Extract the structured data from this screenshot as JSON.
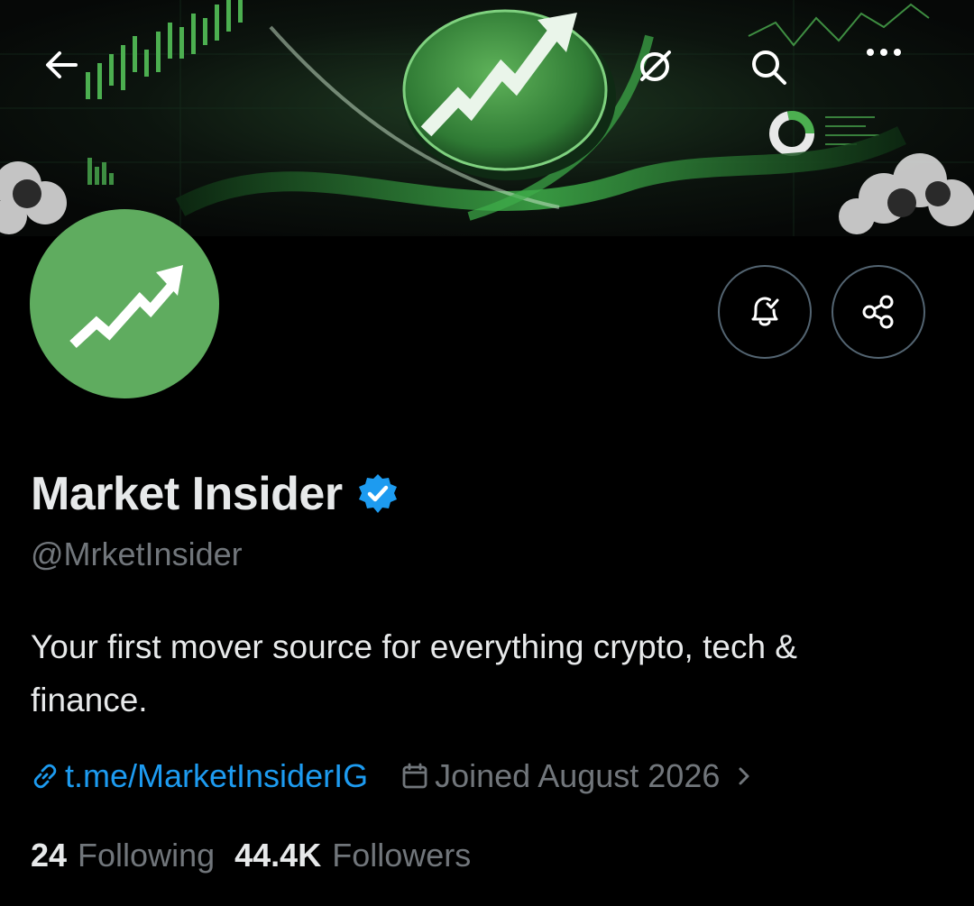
{
  "colors": {
    "background": "#000000",
    "accent_link": "#1d9bf0",
    "verified_blue": "#1d9bf0",
    "avatar_green": "#5fac5f",
    "secondary_text": "#71767b",
    "primary_text": "#e7e9ea",
    "button_border": "#536471"
  },
  "top_bar": {
    "back_icon": "arrow-left-icon",
    "grok_icon": "grok-icon",
    "search_icon": "search-icon",
    "more_icon": "more-horizontal-icon"
  },
  "banner": {
    "description_icon": "trending-up-coin-icon"
  },
  "avatar": {
    "icon": "trending-up-arrow-icon"
  },
  "actions": {
    "notifications_icon": "bell-check-icon",
    "share_icon": "share-icon"
  },
  "profile": {
    "display_name": "Market Insider",
    "handle": "@MrketInsider",
    "bio": "Your first mover source for everything crypto, tech & finance.",
    "link": "t.me/MarketInsiderIG",
    "joined": "Joined August 2026",
    "following_count": "24",
    "following_label": "Following",
    "followers_count": "44.4K",
    "followers_label": "Followers"
  }
}
